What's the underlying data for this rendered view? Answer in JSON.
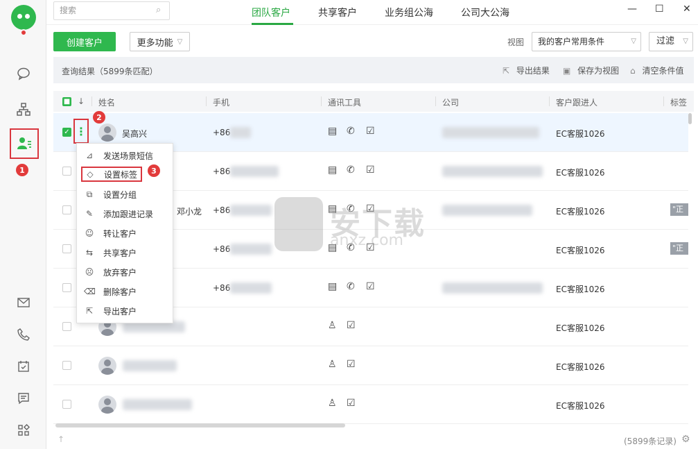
{
  "sidebar": {
    "markers": {
      "one": "1",
      "two": "2",
      "three": "3"
    }
  },
  "topbar": {
    "search_placeholder": "搜索",
    "tabs": [
      {
        "label": "团队客户"
      },
      {
        "label": "共享客户"
      },
      {
        "label": "业务组公海"
      },
      {
        "label": "公司大公海"
      }
    ],
    "window": {
      "minimize": "—",
      "maximize": "☐",
      "close": "✕"
    }
  },
  "toolbar": {
    "create_label": "创建客户",
    "more_label": "更多功能",
    "view_label": "视图",
    "view_value": "我的客户常用条件",
    "filter_label": "过滤"
  },
  "results": {
    "summary": "查询结果（5899条匹配）",
    "export_label": "导出结果",
    "save_view_label": "保存为视图",
    "clear_label": "清空条件值"
  },
  "table": {
    "headers": [
      "姓名",
      "手机",
      "通讯工具",
      "公司",
      "客户跟进人",
      "标签"
    ],
    "sort_icon": "↓",
    "rows": [
      {
        "name": "吴高兴",
        "phone": "+86",
        "follower": "EC客服1026",
        "tag": ""
      },
      {
        "name": "",
        "phone": "+86",
        "follower": "EC客服1026",
        "tag": ""
      },
      {
        "name": "邓小龙",
        "phone": "+86",
        "follower": "EC客服1026",
        "tag": "\"正"
      },
      {
        "name": "",
        "phone": "+86",
        "follower": "EC客服1026",
        "tag": "\"正"
      },
      {
        "name": "",
        "phone": "+86",
        "follower": "EC客服1026",
        "tag": ""
      },
      {
        "name": "",
        "phone": "",
        "follower": "EC客服1026",
        "tag": ""
      },
      {
        "name": "",
        "phone": "",
        "follower": "EC客服1026",
        "tag": ""
      },
      {
        "name": "",
        "phone": "",
        "follower": "EC客服1026",
        "tag": ""
      }
    ]
  },
  "menu": {
    "items": [
      {
        "label": "发送场景短信"
      },
      {
        "label": "设置标签"
      },
      {
        "label": "设置分组"
      },
      {
        "label": "添加跟进记录"
      },
      {
        "label": "转让客户"
      },
      {
        "label": "共享客户"
      },
      {
        "label": "放弃客户"
      },
      {
        "label": "删除客户"
      },
      {
        "label": "导出客户"
      }
    ]
  },
  "footer": {
    "count": "(5899条记录)"
  },
  "watermark": {
    "text": "安下载",
    "sub": "anxz.com"
  }
}
